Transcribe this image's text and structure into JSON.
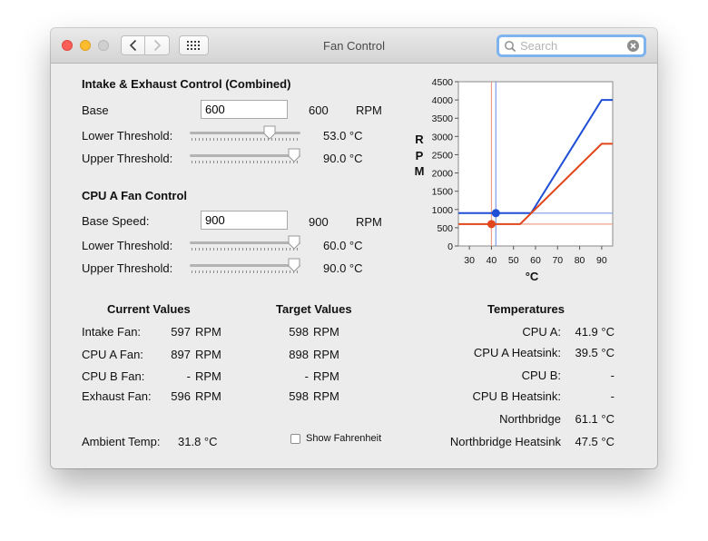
{
  "window": {
    "title": "Fan Control"
  },
  "search": {
    "placeholder": "Search"
  },
  "intake": {
    "title": "Intake & Exhaust Control (Combined)",
    "base_label": "Base",
    "base_value": "600",
    "base_display": "600",
    "base_unit": "RPM",
    "lower_label": "Lower Threshold:",
    "lower_display": "53.0 °C",
    "lower_fraction": 0.75,
    "upper_label": "Upper Threshold:",
    "upper_display": "90.0 °C",
    "upper_fraction": 1.0
  },
  "cpu_a": {
    "title": "CPU A Fan Control",
    "base_label": "Base Speed:",
    "base_value": "900",
    "base_display": "900",
    "base_unit": "RPM",
    "lower_label": "Lower Threshold:",
    "lower_display": "60.0 °C",
    "lower_fraction": 1.0,
    "upper_label": "Upper Threshold:",
    "upper_display": "90.0 °C",
    "upper_fraction": 1.0
  },
  "current": {
    "title": "Current Values",
    "rows": [
      {
        "label": "Intake Fan:",
        "value": "597",
        "unit": "RPM"
      },
      {
        "label": "CPU A Fan:",
        "value": "897",
        "unit": "RPM"
      },
      {
        "label": "CPU B Fan:",
        "value": "-",
        "unit": "RPM"
      },
      {
        "label": "Exhaust Fan:",
        "value": "596",
        "unit": "RPM"
      }
    ]
  },
  "target": {
    "title": "Target Values",
    "rows": [
      {
        "value": "598",
        "unit": "RPM"
      },
      {
        "value": "898",
        "unit": "RPM"
      },
      {
        "value": "-",
        "unit": "RPM"
      },
      {
        "value": "598",
        "unit": "RPM"
      }
    ]
  },
  "temps": {
    "title": "Temperatures",
    "rows": [
      {
        "label": "CPU A:",
        "value": "41.9 °C"
      },
      {
        "label": "CPU A Heatsink:",
        "value": "39.5 °C"
      },
      {
        "label": "CPU B:",
        "value": "-"
      },
      {
        "label": "CPU B Heatsink:",
        "value": "-"
      },
      {
        "label": "Northbridge",
        "value": "61.1 °C"
      },
      {
        "label": "Northbridge Heatsink",
        "value": "47.5 °C"
      }
    ]
  },
  "ambient": {
    "label": "Ambient Temp:",
    "value": "31.8 °C"
  },
  "fahrenheit": {
    "label": "Show Fahrenheit",
    "checked": false
  },
  "chart_data": {
    "type": "line",
    "xlabel": "°C",
    "ylabel": "RPM",
    "xlim": [
      25,
      95
    ],
    "ylim": [
      0,
      4500
    ],
    "xticks": [
      30,
      40,
      50,
      60,
      70,
      80,
      90
    ],
    "yticks": [
      0,
      500,
      1000,
      1500,
      2000,
      2500,
      3000,
      3500,
      4000,
      4500
    ],
    "grid": false,
    "series": [
      {
        "color": "#1f4fd6",
        "x": [
          25,
          58,
          90,
          95
        ],
        "y": [
          900,
          900,
          4000,
          4000
        ],
        "marker": {
          "x": 42,
          "y": 900
        },
        "baseline_y": 900,
        "vline_x": 42
      },
      {
        "color": "#e2461b",
        "x": [
          25,
          53,
          90,
          95
        ],
        "y": [
          600,
          600,
          2800,
          2800
        ],
        "marker": {
          "x": 40,
          "y": 600
        },
        "baseline_y": 600,
        "vline_x": 40
      }
    ]
  }
}
